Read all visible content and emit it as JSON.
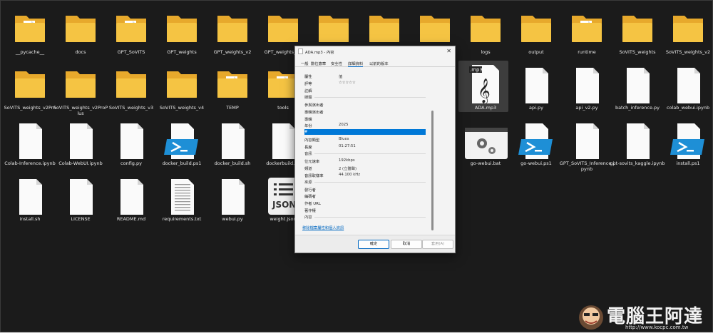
{
  "desktop": {
    "items": [
      {
        "label": "__pycache__",
        "icon": "folder-doc"
      },
      {
        "label": "docs",
        "icon": "folder"
      },
      {
        "label": "GPT_SoVITS",
        "icon": "folder-doc"
      },
      {
        "label": "GPT_weights",
        "icon": "folder"
      },
      {
        "label": "GPT_weights_v2",
        "icon": "folder"
      },
      {
        "label": "GPT_weights_v2",
        "icon": "folder"
      },
      {
        "label": "",
        "icon": "folder"
      },
      {
        "label": "",
        "icon": "folder"
      },
      {
        "label": "",
        "icon": "folder"
      },
      {
        "label": "logs",
        "icon": "folder"
      },
      {
        "label": "output",
        "icon": "folder"
      },
      {
        "label": "runtime",
        "icon": "folder-doc"
      },
      {
        "label": "SoVITS_weights",
        "icon": "folder"
      },
      {
        "label": "SoVITS_weights_v2",
        "icon": "folder"
      },
      {
        "label": "SoVITS_weights_v2Pro",
        "icon": "folder"
      },
      {
        "label": "SoVITS_weights_v2ProPlus",
        "icon": "folder"
      },
      {
        "label": "SoVITS_weights_v3",
        "icon": "folder"
      },
      {
        "label": "SoVITS_weights_v4",
        "icon": "folder"
      },
      {
        "label": "TEMP",
        "icon": "folder-doc"
      },
      {
        "label": "tools",
        "icon": "folder-doc"
      },
      {
        "label": "ADA.mp3",
        "icon": "mp3"
      },
      {
        "label": "api.py",
        "icon": "file"
      },
      {
        "label": "api_v2.py",
        "icon": "file"
      },
      {
        "label": "batch_inference.py",
        "icon": "file"
      },
      {
        "label": "colab_webui.ipynb",
        "icon": "file"
      },
      {
        "label": "Colab-Inference.ipynb",
        "icon": "file"
      },
      {
        "label": "Colab-WebUI.ipynb",
        "icon": "file"
      },
      {
        "label": "config.py",
        "icon": "file"
      },
      {
        "label": "docker_build.ps1",
        "icon": "ps1"
      },
      {
        "label": "docker_build.sh",
        "icon": "file"
      },
      {
        "label": "dockerbuild.sh",
        "icon": "file"
      },
      {
        "label": "go-webui.bat",
        "icon": "bat"
      },
      {
        "label": "go-webui.ps1",
        "icon": "ps1"
      },
      {
        "label": "GPT_SoVITS_Inference.ipynb",
        "icon": "file"
      },
      {
        "label": "gpt-sovits_kaggle.ipynb",
        "icon": "file"
      },
      {
        "label": "install.ps1",
        "icon": "ps1"
      },
      {
        "label": "install.sh",
        "icon": "file"
      },
      {
        "label": "LICENSE",
        "icon": "file"
      },
      {
        "label": "README.md",
        "icon": "file"
      },
      {
        "label": "requirements.txt",
        "icon": "txt"
      },
      {
        "label": "webui.py",
        "icon": "file"
      },
      {
        "label": "weight.json",
        "icon": "json"
      }
    ],
    "mp3_badge": ".mp3",
    "json_badge": "JSON"
  },
  "dialog": {
    "title": "ADA.mp3 - 內容",
    "close": "✕",
    "tabs": [
      "一般",
      "數位簽章",
      "安全性",
      "詳細資料",
      "以前的版本"
    ],
    "header": {
      "prop": "屬性",
      "value": "值"
    },
    "rows": [
      {
        "k": "評等",
        "v": "☆☆☆☆☆"
      },
      {
        "k": "註解",
        "v": ""
      },
      {
        "sec": "媒體"
      },
      {
        "k": "參與演出者",
        "v": ""
      },
      {
        "k": "專輯演出者",
        "v": ""
      },
      {
        "k": "專輯",
        "v": ""
      },
      {
        "k": "年份",
        "v": "2025"
      },
      {
        "k": "#",
        "v": "",
        "hl": true
      },
      {
        "k": "內容類型",
        "v": "Blues"
      },
      {
        "k": "長度",
        "v": "01:27:51"
      },
      {
        "sec": "音訊"
      },
      {
        "k": "位元速率",
        "v": "192kbps"
      },
      {
        "k": "頻道",
        "v": "2 (立體聲)"
      },
      {
        "k": "音訊取樣率",
        "v": "44.100 kHz"
      },
      {
        "sec": "來源"
      },
      {
        "k": "發行者",
        "v": ""
      },
      {
        "k": "編碼者",
        "v": ""
      },
      {
        "k": "作者 URL",
        "v": ""
      },
      {
        "k": "著作權",
        "v": ""
      },
      {
        "sec": "內容"
      }
    ],
    "link": "移除檔案屬性和個人資訊",
    "buttons": {
      "ok": "確定",
      "cancel": "取消",
      "apply": "套用(A)"
    }
  },
  "watermark": {
    "name": "電腦王阿達",
    "url": "http://www.kocpc.com.tw"
  },
  "colors": {
    "desktop": "#1b1b1b",
    "folder": "#f5c443",
    "accent": "#0078d7"
  }
}
